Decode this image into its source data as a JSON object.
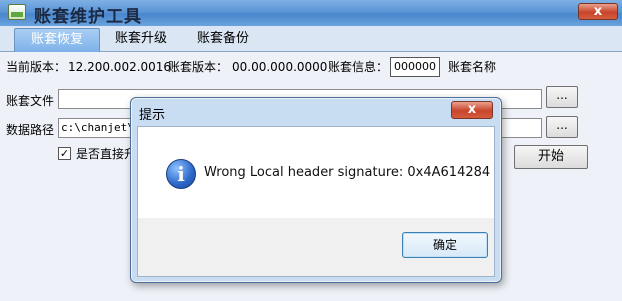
{
  "app": {
    "title": "账套维护工具",
    "close_symbol": "x"
  },
  "tabs": [
    {
      "label": "账套恢复",
      "active": true
    },
    {
      "label": "账套升级",
      "active": false
    },
    {
      "label": "账套备份",
      "active": false
    }
  ],
  "info": {
    "current_version_label": "当前版本：",
    "current_version_value": "12.200.002.0016",
    "account_version_label": "账套版本：",
    "account_version_value": "00.00.000.0000",
    "account_info_label": "账套信息：",
    "account_code": "000000",
    "account_name": "账套名称"
  },
  "form": {
    "account_file_label": "账套文件",
    "account_file_value": "",
    "data_path_label": "数据路径",
    "data_path_value": "c:\\chanjet\\t",
    "browse_label": "...",
    "checkbox_checked": true,
    "checkbox_mark": "✓",
    "checkbox_label": "是否直接升",
    "start_button": "开始"
  },
  "dialog": {
    "title": "提示",
    "close_symbol": "x",
    "icon": "info-icon",
    "icon_glyph": "i",
    "message": "Wrong Local header signature: 0x4A614284",
    "ok_button": "确定"
  },
  "colors": {
    "titlebar": "#5b95d6",
    "tab_active": "#7eb2ea",
    "dialog_frame": "#c8dcf2",
    "close_red": "#c8452b"
  }
}
